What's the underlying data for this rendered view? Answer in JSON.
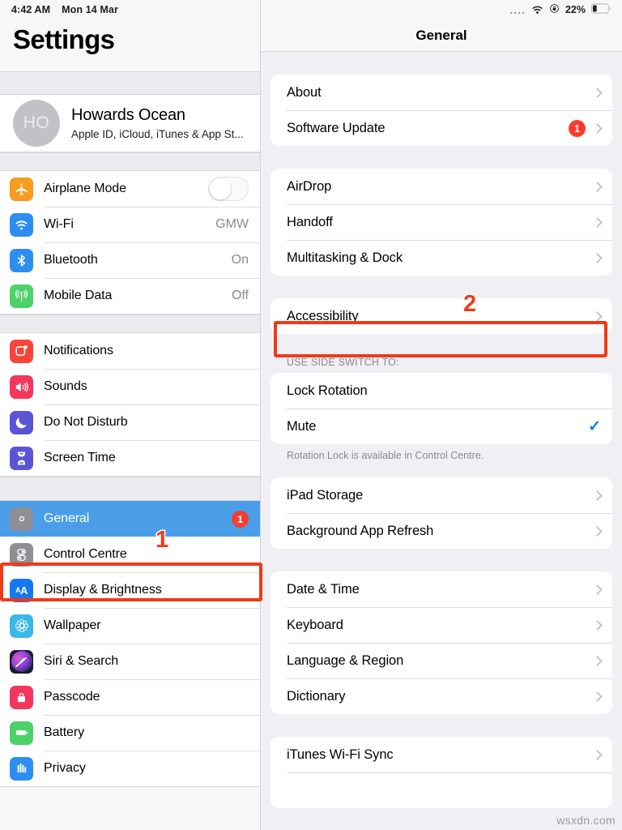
{
  "status_bar": {
    "time": "4:42 AM",
    "date": "Mon 14 Mar",
    "signal_dots": "....",
    "wifi_icon": "wifi-icon",
    "rotation_lock_icon": "rotation-lock-icon",
    "battery_percent": "22%",
    "battery_icon": "battery-icon"
  },
  "sidebar": {
    "title": "Settings",
    "account": {
      "initials": "HO",
      "name": "Howards Ocean",
      "subtitle": "Apple ID, iCloud, iTunes & App St..."
    },
    "groups": [
      {
        "items": [
          {
            "label": "Airplane Mode",
            "icon": "airplane-icon",
            "control": "toggle",
            "toggle_on": false
          },
          {
            "label": "Wi-Fi",
            "icon": "wifi-icon",
            "value": "GMW"
          },
          {
            "label": "Bluetooth",
            "icon": "bluetooth-icon",
            "value": "On"
          },
          {
            "label": "Mobile Data",
            "icon": "cellular-icon",
            "value": "Off"
          }
        ]
      },
      {
        "items": [
          {
            "label": "Notifications",
            "icon": "notifications-icon"
          },
          {
            "label": "Sounds",
            "icon": "sounds-icon"
          },
          {
            "label": "Do Not Disturb",
            "icon": "moon-icon"
          },
          {
            "label": "Screen Time",
            "icon": "hourglass-icon"
          }
        ]
      },
      {
        "items": [
          {
            "label": "General",
            "icon": "gear-icon",
            "selected": true,
            "badge": "1"
          },
          {
            "label": "Control Centre",
            "icon": "control-centre-icon"
          },
          {
            "label": "Display & Brightness",
            "icon": "display-brightness-icon"
          },
          {
            "label": "Wallpaper",
            "icon": "wallpaper-icon"
          },
          {
            "label": "Siri & Search",
            "icon": "siri-icon"
          },
          {
            "label": "Passcode",
            "icon": "passcode-icon"
          },
          {
            "label": "Battery",
            "icon": "battery-icon"
          },
          {
            "label": "Privacy",
            "icon": "privacy-icon"
          }
        ]
      }
    ]
  },
  "main": {
    "nav_title": "General",
    "groups": [
      {
        "header": "",
        "footer": "",
        "rows": [
          {
            "label": "About",
            "chevron": true
          },
          {
            "label": "Software Update",
            "chevron": true,
            "badge": "1"
          }
        ]
      },
      {
        "header": "",
        "footer": "",
        "rows": [
          {
            "label": "AirDrop",
            "chevron": true
          },
          {
            "label": "Handoff",
            "chevron": true
          },
          {
            "label": "Multitasking & Dock",
            "chevron": true
          }
        ]
      },
      {
        "header": "",
        "footer": "",
        "rows": [
          {
            "label": "Accessibility",
            "chevron": true
          }
        ]
      },
      {
        "header": "USE SIDE SWITCH TO:",
        "footer": "Rotation Lock is available in Control Centre.",
        "rows": [
          {
            "label": "Lock Rotation",
            "chevron": false
          },
          {
            "label": "Mute",
            "chevron": false,
            "checked": true
          }
        ]
      },
      {
        "header": "",
        "footer": "",
        "rows": [
          {
            "label": "iPad Storage",
            "chevron": true
          },
          {
            "label": "Background App Refresh",
            "chevron": true
          }
        ]
      },
      {
        "header": "",
        "footer": "",
        "rows": [
          {
            "label": "Date & Time",
            "chevron": true
          },
          {
            "label": "Keyboard",
            "chevron": true
          },
          {
            "label": "Language & Region",
            "chevron": true
          },
          {
            "label": "Dictionary",
            "chevron": true
          }
        ]
      },
      {
        "header": "",
        "footer": "",
        "rows": [
          {
            "label": "iTunes Wi-Fi Sync",
            "chevron": true
          }
        ]
      }
    ]
  },
  "annotations": {
    "marker_one": "1",
    "marker_two": "2",
    "color": "#ee3a1b"
  },
  "watermark": "wsxdn.com",
  "colors": {
    "accent_blue": "#4a9ee8",
    "badge_red": "#fa3b2d",
    "check_blue": "#1478ef",
    "annotation_red": "#ee3a1b"
  }
}
